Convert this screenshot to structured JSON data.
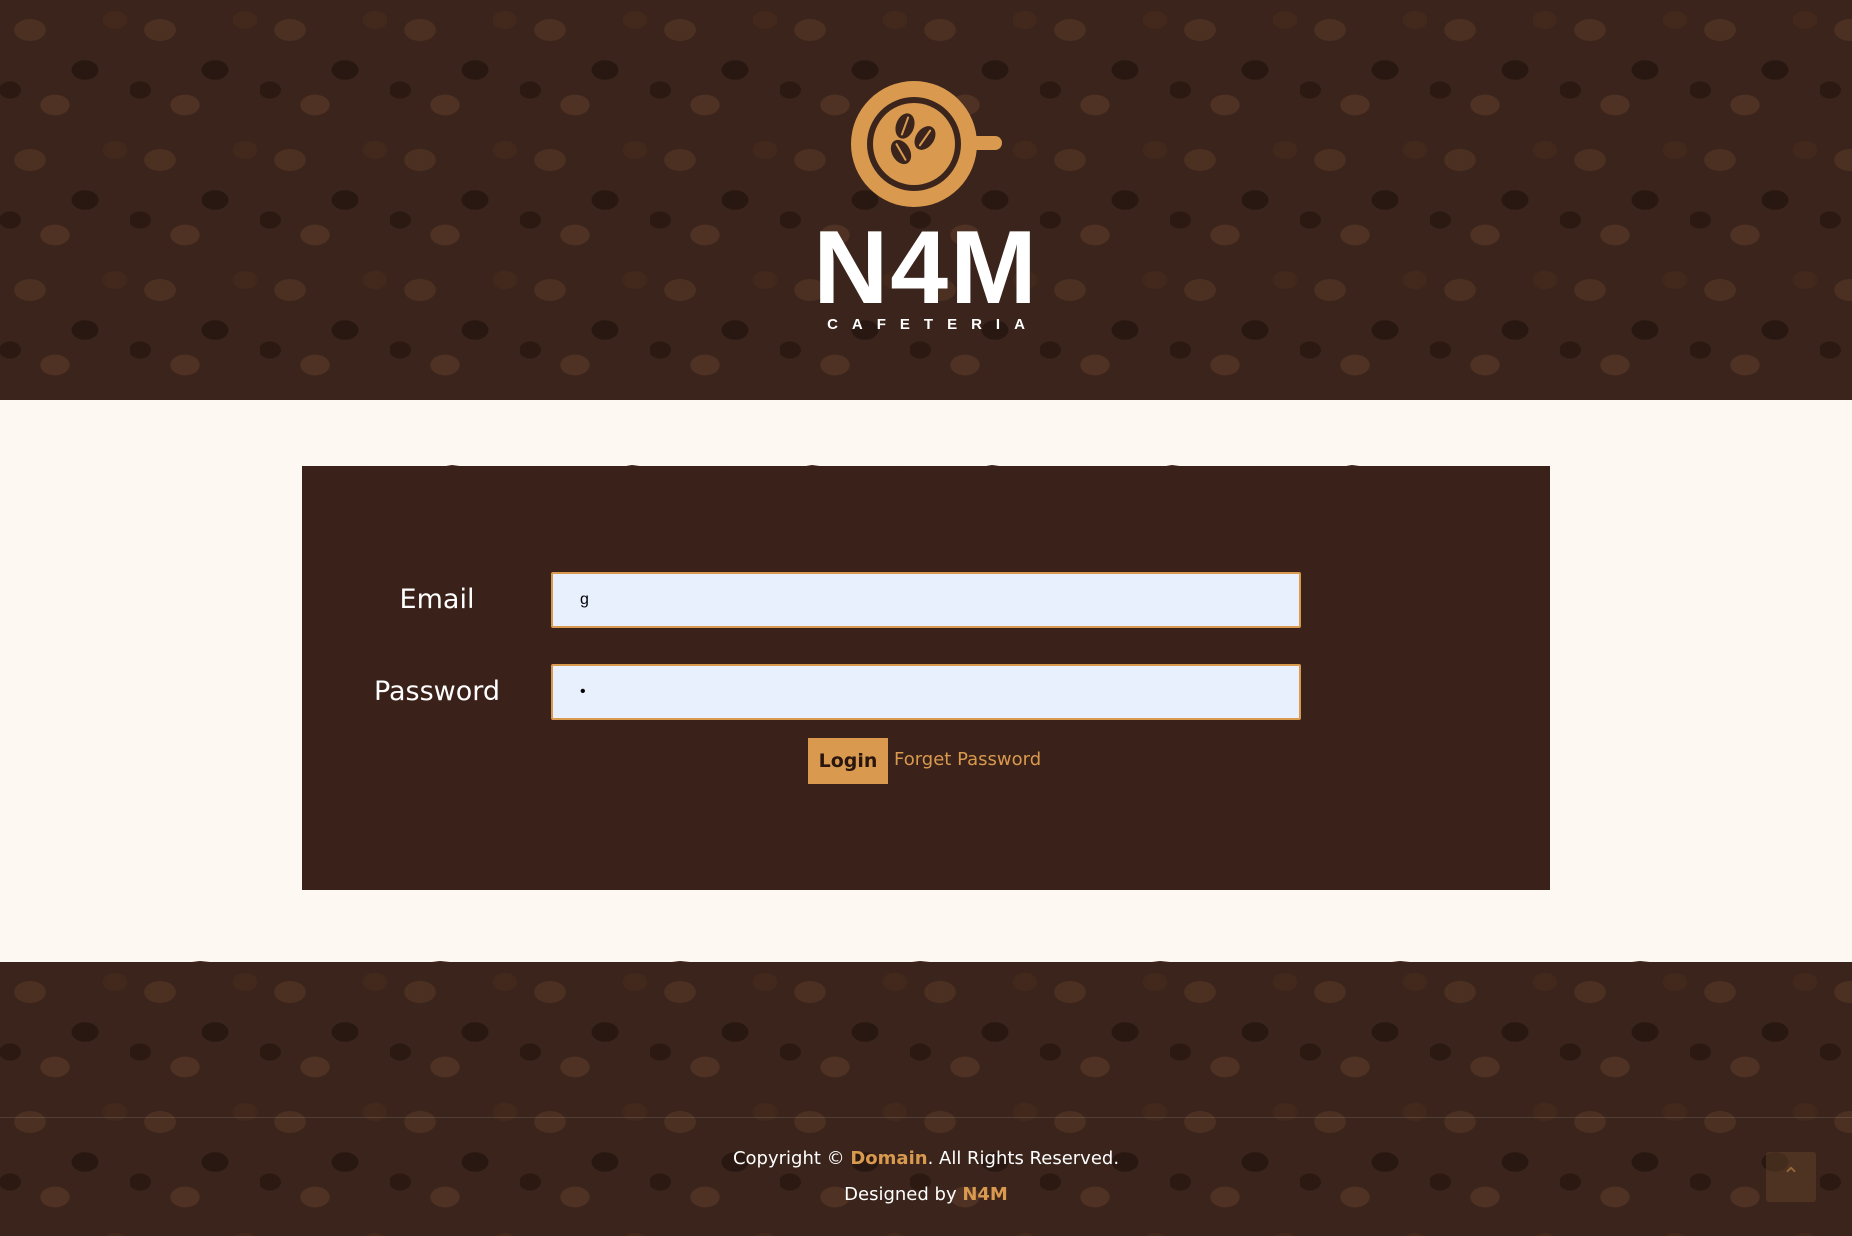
{
  "header": {
    "brand": "N4M",
    "brand_sub": "CAFETERIA"
  },
  "login": {
    "email_label": "Email",
    "email_value": "g",
    "password_label": "Password",
    "password_value": "•",
    "login_button": "Login",
    "forget_link": "Forget Password"
  },
  "footer": {
    "copyright_prefix": "Copyright © ",
    "copyright_link": "Domain",
    "copyright_suffix": ". All Rights Reserved.",
    "designed_prefix": "Designed by ",
    "designed_link": "N4M",
    "back_to_top_icon": "chevron-up-icon"
  },
  "colors": {
    "accent": "#d99a50",
    "dark_brown": "#3a2119",
    "cream": "#fdf8f1",
    "input_bg": "#e8f0fe"
  }
}
